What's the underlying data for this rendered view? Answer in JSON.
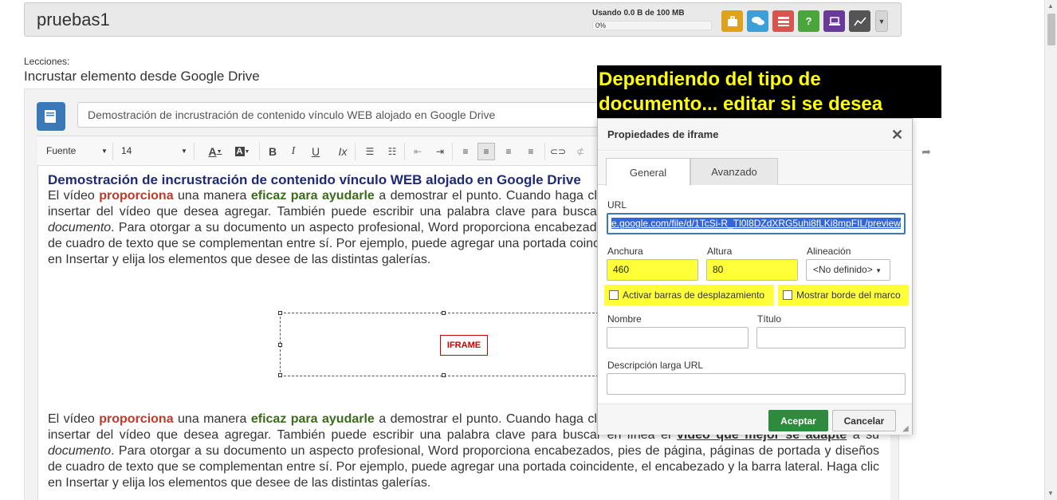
{
  "header": {
    "course_title": "pruebas1",
    "usage_text": "Usando 0.0 B de 100 MB",
    "usage_percent_text": "0%",
    "usage_fraction": 0.0,
    "tools": [
      {
        "icon": "briefcase-icon",
        "color": "#e0a21b"
      },
      {
        "icon": "chat-icon",
        "color": "#3b9fd8"
      },
      {
        "icon": "list-icon",
        "color": "#d9534f"
      },
      {
        "icon": "help-icon",
        "color": "#4aa63c"
      },
      {
        "icon": "laptop-icon",
        "color": "#6a3a9a"
      },
      {
        "icon": "chart-icon",
        "color": "#555555"
      }
    ]
  },
  "lessons": {
    "label": "Lecciones:",
    "title": "Incrustar elemento desde Google Drive"
  },
  "editor": {
    "title_value": "Demostración de incrustración de contenido vínculo WEB alojado en Google Drive",
    "toolbar": {
      "font_label": "Fuente",
      "size_label": "14"
    },
    "heading": "Demostración de incrustración de contenido vínculo WEB alojado en Google Drive",
    "para1": {
      "a": "El vídeo ",
      "b": "proporciona",
      "c": " una manera ",
      "d": "eficaz para ayudarle",
      "e": " a demostrar el punto. Cuando haga clic en Vídeo en línea, puede pegar el código para insertar del vídeo que desea agregar. También puede escribir una palabra clave para buscar en línea el ",
      "f": "vídeo que mejor se adapte",
      "g": " a su ",
      "h": "documento",
      "i": ". Para otorgar a su documento un aspecto profesional, Word proporciona encabezados, pies de página, páginas de portada y diseños de cuadro de texto que se complementan entre sí. Por ejemplo, puede agregar una portada coincidente, el encabezado y la barra lateral. Haga clic en Insertar y elija los elementos que desee de las distintas galerías."
    },
    "iframe_label": "IFRAME"
  },
  "annotation": "Dependiendo del tipo de documento... editar si se desea",
  "dialog": {
    "title": "Propiedades de iframe",
    "tabs": [
      "General",
      "Avanzado"
    ],
    "url_label": "URL",
    "url_value": "e.google.com/file/d/1TcSi-R_Tl0l8DZdXRG5uhi8fLKi8mpFIL/preview",
    "width_label": "Anchura",
    "width_value": "460",
    "height_label": "Altura",
    "height_value": "80",
    "align_label": "Alineación",
    "align_value": "<No definido>",
    "scroll_label": "Activar barras de desplazamiento",
    "border_label": "Mostrar borde del marco",
    "name_label": "Nombre",
    "title_label": "Título",
    "longdesc_label": "Descripción larga URL",
    "ok_label": "Aceptar",
    "cancel_label": "Cancelar"
  }
}
